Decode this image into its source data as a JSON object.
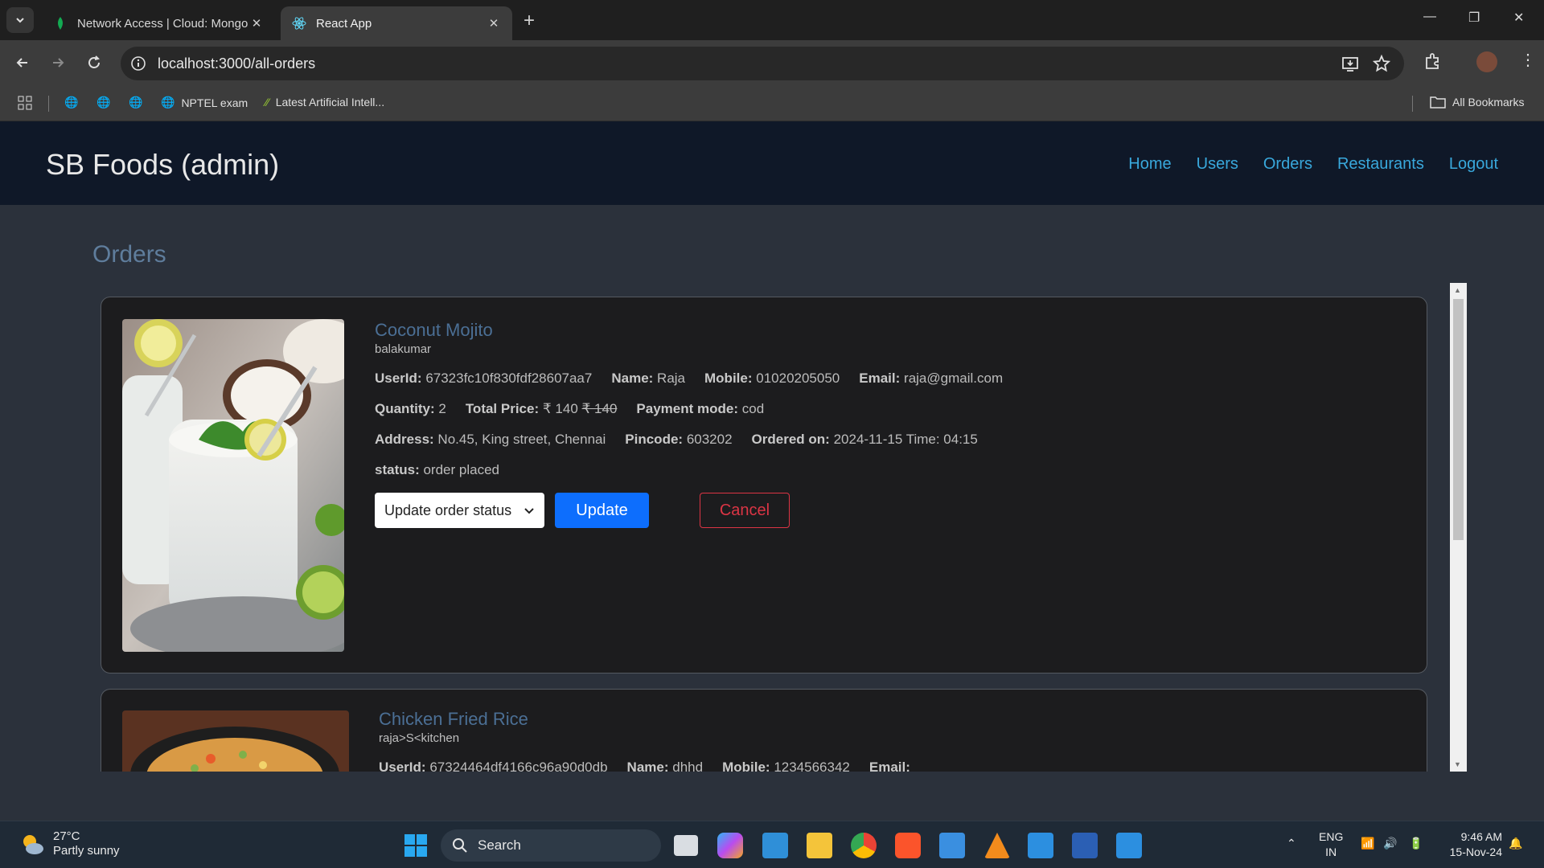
{
  "browser": {
    "tabs": [
      {
        "title": "Network Access | Cloud: Mongo",
        "icon": "mongodb-leaf-icon",
        "active": false
      },
      {
        "title": "React App",
        "icon": "react-icon",
        "active": true
      }
    ],
    "url": "localhost:3000/all-orders",
    "bookmarks": [
      {
        "label": "",
        "icon": "globe-icon"
      },
      {
        "label": "",
        "icon": "globe-icon"
      },
      {
        "label": "",
        "icon": "globe-icon"
      },
      {
        "label": "NPTEL exam",
        "icon": "globe-icon"
      },
      {
        "label": "Latest Artificial Intell...",
        "icon": "ai-leaf-icon"
      }
    ],
    "all_bookmarks": "All Bookmarks"
  },
  "app": {
    "brand": "SB Foods (admin)",
    "nav": [
      "Home",
      "Users",
      "Orders",
      "Restaurants",
      "Logout"
    ],
    "page_title": "Orders"
  },
  "orders": [
    {
      "food": "Coconut Mojito",
      "restaurant": "balakumar",
      "labels": {
        "userid": "UserId:",
        "name": "Name:",
        "mobile": "Mobile:",
        "email": "Email:",
        "quantity": "Quantity:",
        "price": "Total Price:",
        "payment": "Payment mode:",
        "address": "Address:",
        "pincode": "Pincode:",
        "ordered": "Ordered on:",
        "status": "status:"
      },
      "userid": "67323fc10f830fdf28607aa7",
      "name": "Raja",
      "mobile": "01020205050",
      "email": "raja@gmail.com",
      "quantity": "2",
      "price": "₹ 140",
      "price_original": "₹ 140",
      "payment": "cod",
      "address": "No.45, King street, Chennai",
      "pincode": "603202",
      "ordered_on": "2024-11-15 Time: 04:15",
      "status": "order placed",
      "select_placeholder": "Update order status",
      "update_label": "Update",
      "cancel_label": "Cancel"
    },
    {
      "food": "Chicken Fried Rice",
      "restaurant": "raja>S<kitchen",
      "labels": {
        "userid": "UserId:",
        "name": "Name:",
        "mobile": "Mobile:",
        "email": "Email:"
      },
      "userid": "67324464df4166c96a90d0db",
      "name": "dhhd",
      "mobile": "1234566342",
      "email": ""
    }
  ],
  "taskbar": {
    "temperature": "27°C",
    "weather": "Partly sunny",
    "search": "Search",
    "lang1": "ENG",
    "lang2": "IN",
    "time": "9:46 AM",
    "date": "15-Nov-24"
  }
}
